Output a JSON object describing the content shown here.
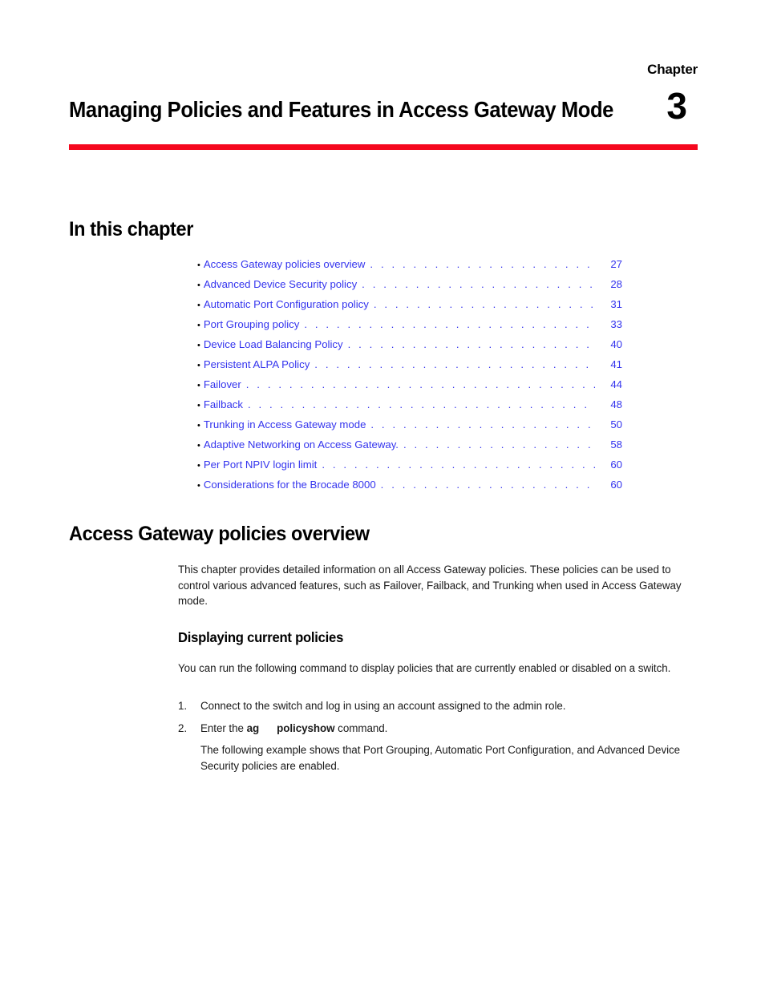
{
  "chapter": {
    "label": "Chapter",
    "number": "3",
    "title": "Managing Policies and Features in Access Gateway Mode",
    "rule_color": "#f5081e"
  },
  "sections": {
    "in_this_chapter": "In this chapter",
    "access_gateway_policies_overview": "Access Gateway policies overview",
    "displaying_current_policies": "Displaying current policies"
  },
  "toc": {
    "bullet": "•",
    "leader": ". . . . . . . . . . . . . . . . . . . . . . . . . . . . . . . . . . . . . . . . . . . . . . . . . . . . . . . . . . . . . . . . . . . . . . . .",
    "link_color": "#3434ee",
    "entries": [
      {
        "label": "Access Gateway policies overview",
        "page": "27"
      },
      {
        "label": "Advanced Device Security policy",
        "page": "28"
      },
      {
        "label": "Automatic Port Configuration policy",
        "page": "31"
      },
      {
        "label": "Port Grouping policy",
        "page": "33"
      },
      {
        "label": "Device Load Balancing Policy",
        "page": "40"
      },
      {
        "label": "Persistent ALPA Policy",
        "page": "41"
      },
      {
        "label": "Failover",
        "page": "44"
      },
      {
        "label": "Failback",
        "page": "48"
      },
      {
        "label": "Trunking in Access Gateway mode",
        "page": "50"
      },
      {
        "label": "Adaptive Networking on Access Gateway.",
        "page": "58"
      },
      {
        "label": "Per Port NPIV login limit",
        "page": "60"
      },
      {
        "label": "Considerations for the Brocade 8000",
        "page": "60"
      }
    ]
  },
  "body": {
    "intro_paragraph": "This chapter provides detailed information on all Access Gateway policies. These policies can be used to control various advanced features, such as Failover, Failback, and Trunking when used in Access Gateway mode.",
    "displaying_paragraph": "You can run the following command to display policies that are currently enabled or disabled on a switch.",
    "example_paragraph": "The following example shows that Port Grouping, Automatic Port Configuration, and Advanced Device Security policies are enabled."
  },
  "steps": [
    {
      "marker": "1.",
      "text_before": "Connect to the switch and log in using an account assigned to the admin role.",
      "command_first": "",
      "command_second": "",
      "text_after": ""
    },
    {
      "marker": "2.",
      "text_before": "Enter the ",
      "command_first": "ag",
      "command_second": "policyshow",
      "text_after": " command."
    }
  ]
}
